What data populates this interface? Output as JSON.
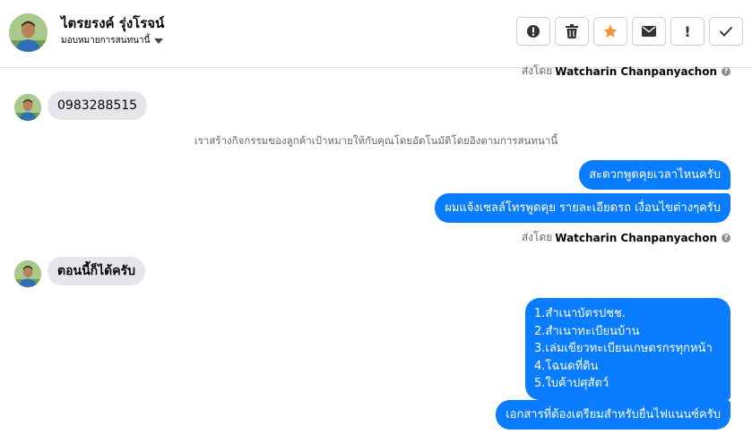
{
  "header": {
    "contact_name": "ไตรยรงค์ รุ่งโรจน์",
    "assign_label": "มอบหมายการสนทนานี้",
    "toolbar": [
      {
        "name": "spam-report-button",
        "icon": "alert-circle-icon"
      },
      {
        "name": "delete-button",
        "icon": "trash-icon"
      },
      {
        "name": "star-button",
        "icon": "star-icon",
        "color": "#f7923a"
      },
      {
        "name": "mark-unread-button",
        "icon": "envelope-icon"
      },
      {
        "name": "mark-important-button",
        "icon": "exclamation-icon",
        "text": "!"
      },
      {
        "name": "mark-done-button",
        "icon": "checkmark-icon"
      }
    ]
  },
  "sent_by_prefix": "ส่งโดย",
  "sent_by_name": "Watcharin Chanpanyachon",
  "messages": {
    "phone": "0983288515",
    "system_note": "เราสร้างกิจกรรมของลูกค้าเป้าหมายให้กับคุณโดยอัตโนมัติโดยอิงตามการสนทนานี้",
    "out_1": "สะดวกพูดคุยเวลาไหนครับ",
    "out_2": "ผมแจ้งเซลล์โทรพูดคุย รายละเอียดรถ เงื่อนไขต่างๆครับ",
    "in_2": "ตอนนี้ก็ได้ครับ",
    "doc_list": [
      "1.สำเนาบัตรปชช.",
      "2.สำเนาทะเบียนบ้าน",
      "3.เล่มเขียวทะเบียนเกษตรกรทุกหน้า",
      "4.โฉนดที่ดิน",
      "5.ใบค้าปศุสัตว์"
    ],
    "out_docs": "เอกสารที่ต้องเตรียมสำหรับยื่นไฟแนนซ์ครับ"
  },
  "colors": {
    "outgoing_bubble": "#0a7cff",
    "incoming_bubble": "#e4e6eb",
    "star": "#f7923a"
  }
}
